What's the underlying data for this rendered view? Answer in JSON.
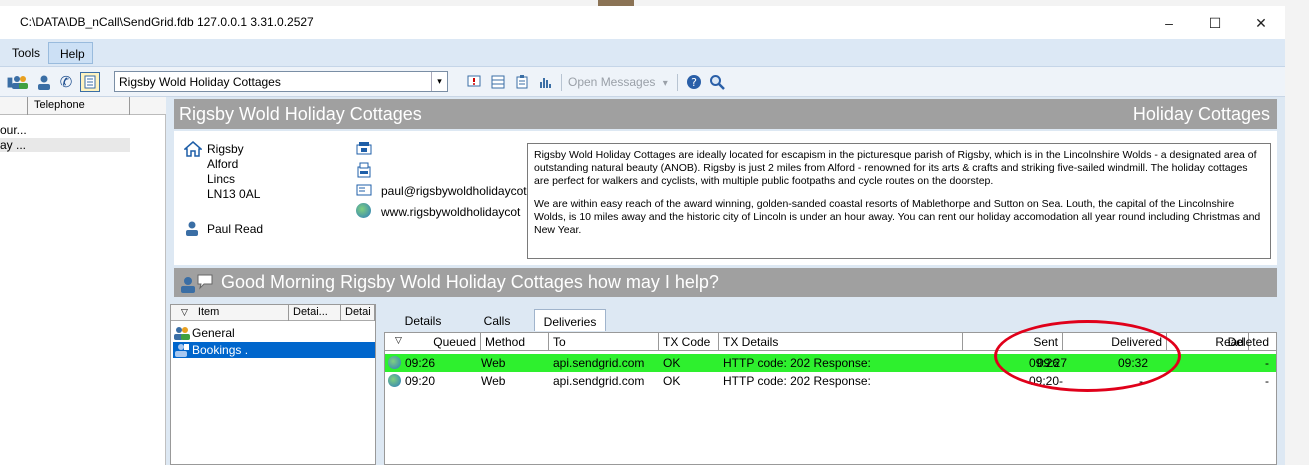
{
  "window": {
    "title": "C:\\DATA\\DB_nCall\\SendGrid.fdb 127.0.0.1 3.31.0.2527",
    "controls": [
      "minimize-icon",
      "maximize-icon",
      "close-icon"
    ]
  },
  "menu": {
    "tools": "Tools",
    "help": "Help"
  },
  "toolbar": {
    "company_combo": "Rigsby Wold Holiday Cottages",
    "open_messages": "Open Messages",
    "dropdown_arrow": "▾"
  },
  "left_list": {
    "header_telephone": "Telephone",
    "rows": [
      "our...",
      "ay ..."
    ]
  },
  "contact": {
    "name": "Rigsby Wold Holiday Cottages",
    "category": "Holiday Cottages",
    "address": [
      "Rigsby",
      "Alford",
      "Lincs",
      "LN13 0AL"
    ],
    "person": "Paul Read",
    "email": "paul@rigsbywoldholidaycot",
    "website": "www.rigsbywoldholidaycot",
    "description_p1": "Rigsby Wold Holiday Cottages are ideally located for escapism in the picturesque parish of Rigsby, which is in the Lincolnshire Wolds - a designated area of outstanding natural beauty (ANOB). Rigsby is just 2 miles from Alford - renowned for its arts & crafts and striking five-sailed windmill. The holiday cottages are perfect for walkers and cyclists, with multiple public footpaths and cycle routes on the doorstep.",
    "description_p2": "We are within easy reach of the award winning, golden-sanded coastal resorts of Mablethorpe and Sutton on Sea. Louth, the capital of the Lincolnshire Wolds, is 10 miles away and the historic city of Lincoln is under an hour away. You can rent our holiday accomodation all year round including Christmas and New Year."
  },
  "greeting": "Good Morning  Rigsby Wold Holiday Cottages how may I help?",
  "items": {
    "headers": [
      "Item",
      "Detai...",
      "Detai"
    ],
    "rows": [
      {
        "label": "General",
        "selected": false
      },
      {
        "label": "Bookings .",
        "selected": true
      }
    ]
  },
  "tabs": [
    "Details",
    "Calls",
    "Deliveries"
  ],
  "active_tab": "Deliveries",
  "deliveries": {
    "headers": {
      "queued": "Queued",
      "method": "Method",
      "to": "To",
      "tx_code": "TX Code",
      "tx_details": "TX Details",
      "sent": "Sent",
      "delivered": "Delivered",
      "read": "Read",
      "deleted": "Deleted"
    },
    "rows": [
      {
        "queued": "09:26",
        "method": "Web",
        "to": "api.sendgrid.com",
        "tx_code": "OK",
        "tx_details": "HTTP code: 202 Response:",
        "sent": "09:26",
        "delivered": "09:27",
        "read": "09:32",
        "deleted": "-",
        "highlighted": true
      },
      {
        "queued": "09:20",
        "method": "Web",
        "to": "api.sendgrid.com",
        "tx_code": "OK",
        "tx_details": "HTTP code: 202 Response:",
        "sent": "09:20",
        "delivered": "-",
        "read": "-",
        "deleted": "-",
        "highlighted": false
      }
    ]
  },
  "colors": {
    "highlight_row": "#2ef02e",
    "annotation": "#e0001a",
    "banner": "#a0a0a0",
    "selection": "#0066cc"
  }
}
